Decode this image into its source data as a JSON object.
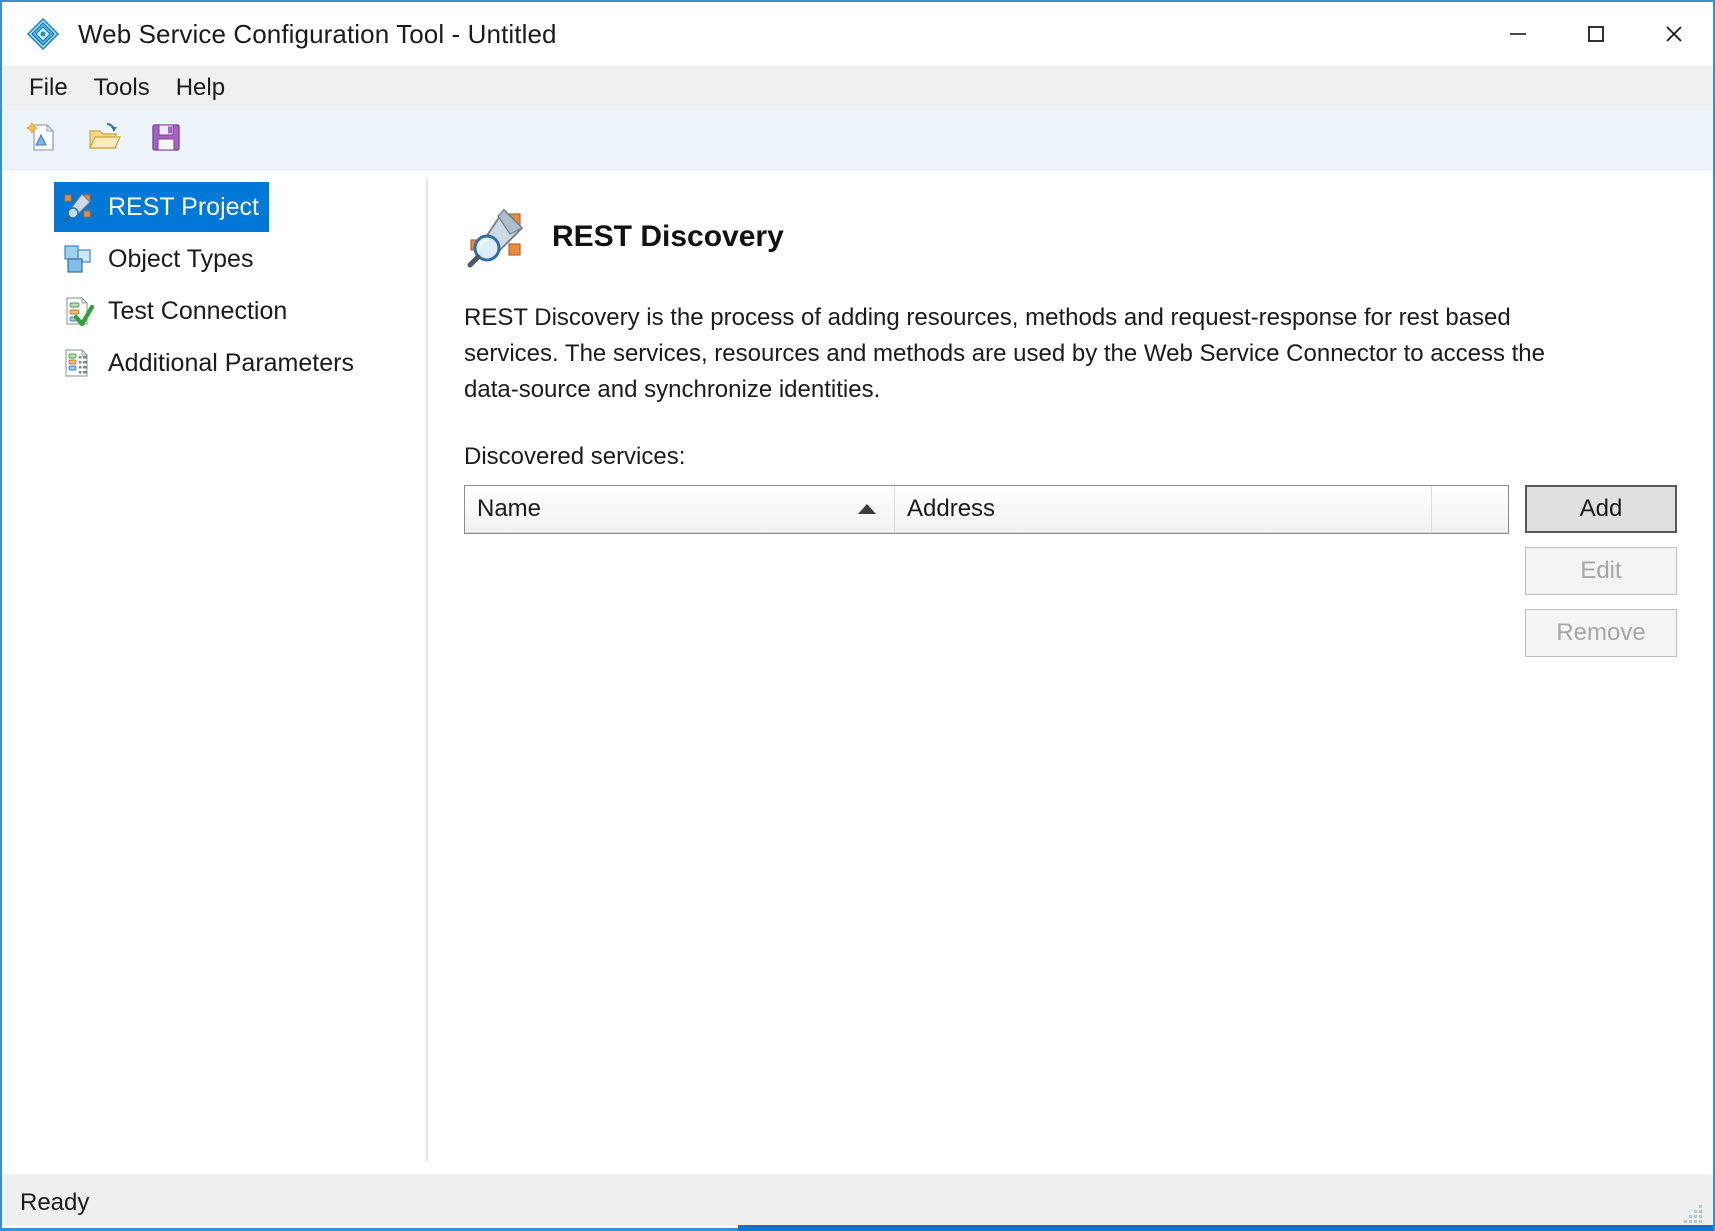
{
  "window": {
    "title": "Web Service Configuration Tool - Untitled",
    "app_icon": "diamond-app-icon",
    "controls": {
      "minimize": "minimize-button",
      "maximize": "maximize-button",
      "close": "close-button"
    },
    "accent_color": "#0078d7",
    "border_color": "#3a8fd4"
  },
  "menubar": {
    "items": [
      {
        "label": "File"
      },
      {
        "label": "Tools"
      },
      {
        "label": "Help"
      }
    ]
  },
  "toolbar": {
    "buttons": [
      {
        "name": "new-project-icon",
        "tooltip": "New"
      },
      {
        "name": "open-project-icon",
        "tooltip": "Open"
      },
      {
        "name": "save-project-icon",
        "tooltip": "Save"
      }
    ]
  },
  "sidebar": {
    "items": [
      {
        "label": "REST Project",
        "icon": "rest-project-icon",
        "selected": true
      },
      {
        "label": "Object Types",
        "icon": "object-types-icon",
        "selected": false
      },
      {
        "label": "Test Connection",
        "icon": "test-connection-icon",
        "selected": false
      },
      {
        "label": "Additional Parameters",
        "icon": "additional-parameters-icon",
        "selected": false
      }
    ]
  },
  "content": {
    "page_icon": "rest-discovery-icon",
    "page_title": "REST Discovery",
    "description": "REST Discovery is the process of adding resources, methods and request-response for rest based services. The services, resources and methods are used by the Web Service Connector to access the data-source and synchronize identities.",
    "list_label": "Discovered services:",
    "table": {
      "columns": [
        {
          "label": "Name",
          "sort": "ascending"
        },
        {
          "label": "Address",
          "sort": "none"
        },
        {
          "label": "",
          "sort": "none"
        }
      ],
      "rows": []
    },
    "buttons": [
      {
        "label": "Add",
        "state": "default"
      },
      {
        "label": "Edit",
        "state": "disabled"
      },
      {
        "label": "Remove",
        "state": "disabled"
      }
    ]
  },
  "statusbar": {
    "text": "Ready",
    "grip": "resize-grip-icon"
  }
}
